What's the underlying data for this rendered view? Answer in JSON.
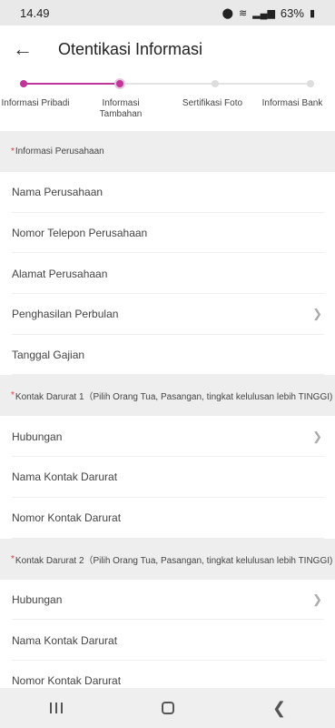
{
  "status": {
    "time": "14.49",
    "battery": "63%"
  },
  "header": {
    "title": "Otentikasi Informasi"
  },
  "stepper": {
    "steps": [
      {
        "label": "Informasi Pribadi",
        "state": "done"
      },
      {
        "label": "Informasi Tambahan",
        "state": "current"
      },
      {
        "label": "Sertifikasi Foto",
        "state": "pending"
      },
      {
        "label": "Informasi Bank",
        "state": "pending"
      }
    ]
  },
  "sections": [
    {
      "title": "Informasi Perusahaan",
      "fields": [
        {
          "label": "Nama Perusahaan"
        },
        {
          "label": "Nomor Telepon Perusahaan"
        },
        {
          "label": "Alamat Perusahaan"
        },
        {
          "label": "Penghasilan Perbulan",
          "chevron": true
        },
        {
          "label": "Tanggal Gajian"
        }
      ]
    },
    {
      "title": "Kontak Darurat 1（Pilih Orang Tua, Pasangan, tingkat kelulusan lebih TINGGI)",
      "fields": [
        {
          "label": "Hubungan",
          "chevron": true
        },
        {
          "label": "Nama Kontak Darurat"
        },
        {
          "label": "Nomor Kontak Darurat"
        }
      ]
    },
    {
      "title": "Kontak Darurat 2（Pilih Orang Tua, Pasangan, tingkat kelulusan lebih TINGGI)",
      "fields": [
        {
          "label": "Hubungan",
          "chevron": true
        },
        {
          "label": "Nama Kontak Darurat"
        },
        {
          "label": "Nomor Kontak Darurat"
        }
      ]
    }
  ],
  "colors": {
    "accent": "#c0359a",
    "required": "#e23b3b",
    "section_bg": "#eeeeee"
  }
}
